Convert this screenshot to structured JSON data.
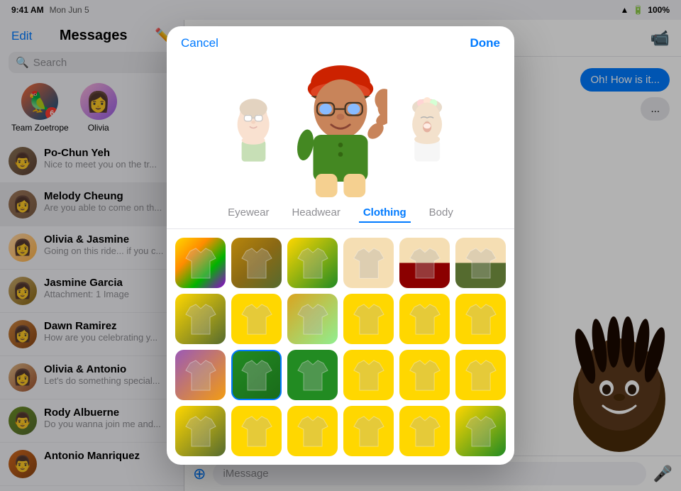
{
  "statusBar": {
    "time": "9:41 AM",
    "date": "Mon Jun 5",
    "battery": "100%",
    "wifi": true
  },
  "sidebar": {
    "editLabel": "Edit",
    "title": "Messages",
    "searchPlaceholder": "Search",
    "pinnedContacts": [
      {
        "name": "Team Zoetrope",
        "avatarClass": "av-team",
        "hasBadge": true,
        "badge": "6"
      },
      {
        "name": "Olivia",
        "avatarClass": "av-olivia"
      }
    ],
    "conversations": [
      {
        "name": "Po-Chun Yeh",
        "preview": "Nice to meet you on the tr...",
        "avatarClass": "av-pochun"
      },
      {
        "name": "Melody Cheung",
        "preview": "Are you able to come on th...",
        "avatarClass": "av-melody",
        "active": true
      },
      {
        "name": "Olivia & Jasmine",
        "preview": "Going on this ride... if you c...",
        "avatarClass": "av-olivia2"
      },
      {
        "name": "Jasmine Garcia",
        "preview": "Attachment: 1 Image",
        "avatarClass": "av-jasmine"
      },
      {
        "name": "Dawn Ramirez",
        "preview": "How are you celebrating y...",
        "avatarClass": "av-dawn"
      },
      {
        "name": "Olivia & Antonio",
        "preview": "Let's do something special...",
        "avatarClass": "av-olivia3"
      },
      {
        "name": "Rody Albuerne",
        "preview": "Do you wanna join me and...",
        "avatarClass": "av-rody"
      },
      {
        "name": "Antonio Manriquez",
        "preview": "",
        "avatarClass": "av-antonio"
      }
    ]
  },
  "chat": {
    "bubble1": "Oh! How is it...",
    "bubble2": "...",
    "inputPlaceholder": "iMessage",
    "videoIcon": "📹",
    "micIcon": "🎤"
  },
  "modal": {
    "cancelLabel": "Cancel",
    "doneLabel": "Done",
    "tabs": [
      {
        "id": "eyewear",
        "label": "Eyewear",
        "active": false
      },
      {
        "id": "headwear",
        "label": "Headwear",
        "active": false
      },
      {
        "id": "clothing",
        "label": "Clothing",
        "active": true
      },
      {
        "id": "body",
        "label": "Body",
        "active": false
      }
    ],
    "clothingItems": [
      {
        "row": 0,
        "col": 0,
        "colorClass": "cloth-row0-col0",
        "selected": false
      },
      {
        "row": 0,
        "col": 1,
        "colorClass": "cloth-row0-col1",
        "selected": false
      },
      {
        "row": 0,
        "col": 2,
        "colorClass": "cloth-row0-col2",
        "selected": false
      },
      {
        "row": 0,
        "col": 3,
        "colorClass": "cloth-row0-col3",
        "selected": false
      },
      {
        "row": 0,
        "col": 4,
        "colorClass": "cloth-row0-col4",
        "selected": false
      },
      {
        "row": 0,
        "col": 5,
        "colorClass": "cloth-row0-col5",
        "selected": false
      },
      {
        "row": 1,
        "col": 0,
        "colorClass": "cloth-row1-col0",
        "selected": false
      },
      {
        "row": 1,
        "col": 1,
        "colorClass": "cloth-row1-col1",
        "selected": false
      },
      {
        "row": 1,
        "col": 2,
        "colorClass": "cloth-row1-col2",
        "selected": false
      },
      {
        "row": 1,
        "col": 3,
        "colorClass": "cloth-row1-col3",
        "selected": false
      },
      {
        "row": 1,
        "col": 4,
        "colorClass": "cloth-row1-col4",
        "selected": false
      },
      {
        "row": 1,
        "col": 5,
        "colorClass": "cloth-row1-col5",
        "selected": false
      },
      {
        "row": 2,
        "col": 0,
        "colorClass": "cloth-row2-col0",
        "selected": false
      },
      {
        "row": 2,
        "col": 1,
        "colorClass": "cloth-row2-col1",
        "selected": true
      },
      {
        "row": 2,
        "col": 2,
        "colorClass": "cloth-row2-col2",
        "selected": false
      },
      {
        "row": 2,
        "col": 3,
        "colorClass": "cloth-row2-col3",
        "selected": false
      },
      {
        "row": 2,
        "col": 4,
        "colorClass": "cloth-row2-col4",
        "selected": false
      },
      {
        "row": 2,
        "col": 5,
        "colorClass": "cloth-row2-col5",
        "selected": false
      },
      {
        "row": 3,
        "col": 0,
        "colorClass": "cloth-row3-col0",
        "selected": false
      },
      {
        "row": 3,
        "col": 1,
        "colorClass": "cloth-row3-col1",
        "selected": false
      },
      {
        "row": 3,
        "col": 2,
        "colorClass": "cloth-row3-col2",
        "selected": false
      },
      {
        "row": 3,
        "col": 3,
        "colorClass": "cloth-row3-col3",
        "selected": false
      },
      {
        "row": 3,
        "col": 4,
        "colorClass": "cloth-row3-col4",
        "selected": false
      },
      {
        "row": 3,
        "col": 5,
        "colorClass": "cloth-row3-col5",
        "selected": false
      }
    ]
  }
}
